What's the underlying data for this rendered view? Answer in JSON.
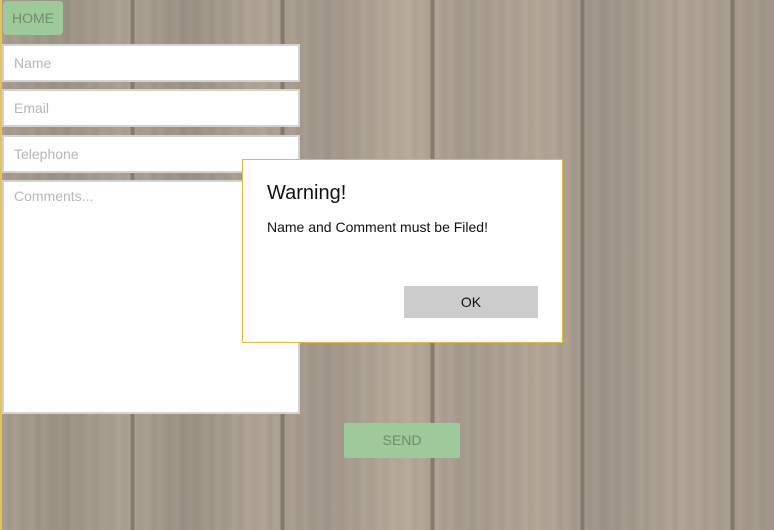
{
  "nav": {
    "home_label": "HOME"
  },
  "form": {
    "name_placeholder": "Name",
    "email_placeholder": "Email",
    "telephone_placeholder": "Telephone",
    "comments_placeholder": "Comments...",
    "send_label": "SEND"
  },
  "dialog": {
    "title": "Warning!",
    "message": "Name and Comment must be Filed!",
    "ok_label": "OK"
  },
  "colors": {
    "button_green": "#9ec99a",
    "dialog_border": "#e5b93a",
    "ok_button_gray": "#cccccc"
  }
}
